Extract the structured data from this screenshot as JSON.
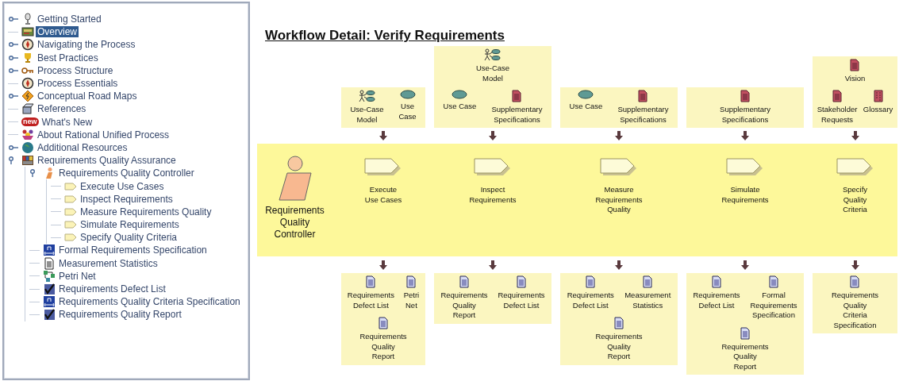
{
  "tree": {
    "items": [
      {
        "label": "Getting Started",
        "kind": "microphone",
        "expanded": false,
        "selected": false
      },
      {
        "label": "Overview",
        "kind": "overview",
        "selected": true
      },
      {
        "label": "Navigating the Process",
        "kind": "compass",
        "expanded": false,
        "selected": false
      },
      {
        "label": "Best Practices",
        "kind": "trophy",
        "expanded": false,
        "selected": false
      },
      {
        "label": "Process Structure",
        "kind": "key",
        "expanded": false,
        "selected": false
      },
      {
        "label": "Process Essentials",
        "kind": "compass",
        "selected": false
      },
      {
        "label": "Conceptual Road Maps",
        "kind": "roadsign",
        "expanded": false,
        "selected": false
      },
      {
        "label": "References",
        "kind": "book",
        "selected": false
      },
      {
        "label": "What's New",
        "kind": "badge",
        "badge": "new",
        "selected": false
      },
      {
        "label": "About Rational Unified Process",
        "kind": "people",
        "selected": false
      },
      {
        "label": "Additional Resources",
        "kind": "globe",
        "expanded": false,
        "selected": false
      },
      {
        "label": "Requirements Quality Assurance",
        "kind": "bookshelf",
        "expanded": true,
        "selected": false,
        "children": [
          {
            "label": "Requirements Quality Controller",
            "kind": "worker",
            "expanded": true,
            "selected": false,
            "children": [
              {
                "label": "Execute Use Cases",
                "kind": "task",
                "selected": false
              },
              {
                "label": "Inspect Requirements",
                "kind": "task",
                "selected": false
              },
              {
                "label": "Measure Requirements Quality",
                "kind": "task",
                "selected": false
              },
              {
                "label": "Simulate Requirements",
                "kind": "task",
                "selected": false
              },
              {
                "label": "Specify Quality Criteria",
                "kind": "task",
                "selected": false
              }
            ]
          },
          {
            "label": "Formal Requirements Specification",
            "kind": "spec",
            "selected": false
          },
          {
            "label": "Measurement Statistics",
            "kind": "document",
            "selected": false
          },
          {
            "label": "Petri Net",
            "kind": "network",
            "selected": false
          },
          {
            "label": "Requirements Defect List",
            "kind": "checklist",
            "selected": false
          },
          {
            "label": "Requirements Quality Criteria Specification",
            "kind": "spec",
            "selected": false
          },
          {
            "label": "Requirements Quality Report",
            "kind": "checklist",
            "selected": false
          }
        ]
      }
    ]
  },
  "workflow": {
    "title": "Workflow Detail: Verify Requirements",
    "role": {
      "name": "Requirements Quality Controller"
    },
    "columns": [
      {
        "inputs": [
          [
            {
              "kind": "use-case-model",
              "label": "Use-Case\nModel"
            },
            {
              "kind": "use-case",
              "label": "Use\nCase"
            }
          ]
        ],
        "task": "Execute\nUse Cases",
        "outputs": [
          [
            {
              "kind": "report",
              "label": "Requirements\nDefect List"
            },
            {
              "kind": "report",
              "label": "Petri\nNet"
            }
          ],
          [
            {
              "kind": "report",
              "label": "Requirements\nQuality\nReport"
            }
          ]
        ]
      },
      {
        "inputs": [
          [
            {
              "kind": "use-case-model",
              "label": "Use-Case\nModel"
            }
          ],
          [
            {
              "kind": "use-case",
              "label": "Use Case"
            },
            {
              "kind": "document",
              "label": "Supplementary\nSpecifications"
            }
          ]
        ],
        "task": "Inspect\nRequirements",
        "outputs": [
          [
            {
              "kind": "report",
              "label": "Requirements\nQuality\nReport"
            },
            {
              "kind": "report",
              "label": "Requirements\nDefect List"
            }
          ]
        ]
      },
      {
        "inputs": [
          [
            {
              "kind": "use-case",
              "label": "Use Case"
            },
            {
              "kind": "document",
              "label": "Supplementary\nSpecifications"
            }
          ]
        ],
        "task": "Measure\nRequirements\nQuality",
        "outputs": [
          [
            {
              "kind": "report",
              "label": "Requirements\nDefect List"
            },
            {
              "kind": "report",
              "label": "Measurement\nStatistics"
            }
          ],
          [
            {
              "kind": "report",
              "label": "Requirements\nQuality\nReport"
            }
          ]
        ]
      },
      {
        "inputs": [
          [
            {
              "kind": "document",
              "label": "Supplementary\nSpecifications"
            }
          ]
        ],
        "task": "Simulate\nRequirements",
        "outputs": [
          [
            {
              "kind": "report",
              "label": "Requirements\nDefect List"
            },
            {
              "kind": "report",
              "label": "Formal\nRequirements\nSpecification"
            }
          ],
          [
            {
              "kind": "report",
              "label": "Requirements\nQuality\nReport"
            }
          ]
        ]
      },
      {
        "inputs": [
          [
            {
              "kind": "document",
              "label": "Vision"
            }
          ],
          [
            {
              "kind": "document",
              "label": "Stakeholder\nRequests"
            },
            {
              "kind": "glossary",
              "label": "Glossary"
            }
          ]
        ],
        "task": "Specify\nQuality\nCriteria",
        "outputs": [
          [
            {
              "kind": "report",
              "label": "Requirements\nQuality\nCriteria\nSpecification"
            }
          ]
        ]
      }
    ]
  }
}
